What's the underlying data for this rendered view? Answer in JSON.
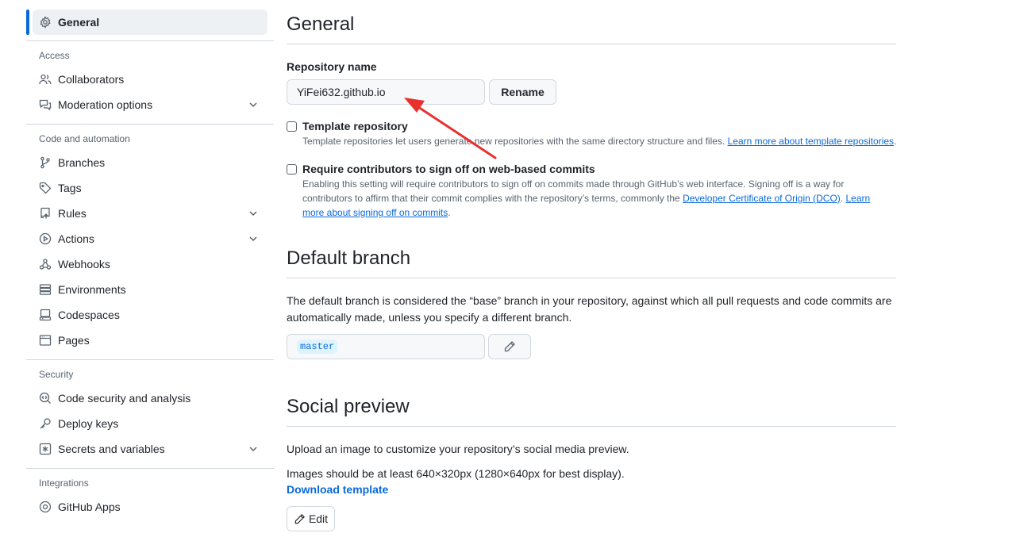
{
  "sidebar": {
    "active": {
      "label": "General",
      "icon": "gear-icon"
    },
    "groups": [
      {
        "title": "Access",
        "items": [
          {
            "label": "Collaborators",
            "icon": "people-icon",
            "expandable": false
          },
          {
            "label": "Moderation options",
            "icon": "comment-discussion-icon",
            "expandable": true
          }
        ]
      },
      {
        "title": "Code and automation",
        "items": [
          {
            "label": "Branches",
            "icon": "git-branch-icon",
            "expandable": false
          },
          {
            "label": "Tags",
            "icon": "tag-icon",
            "expandable": false
          },
          {
            "label": "Rules",
            "icon": "repo-push-icon",
            "expandable": true
          },
          {
            "label": "Actions",
            "icon": "play-icon",
            "expandable": true
          },
          {
            "label": "Webhooks",
            "icon": "webhook-icon",
            "expandable": false
          },
          {
            "label": "Environments",
            "icon": "server-icon",
            "expandable": false
          },
          {
            "label": "Codespaces",
            "icon": "codespaces-icon",
            "expandable": false
          },
          {
            "label": "Pages",
            "icon": "browser-icon",
            "expandable": false
          }
        ]
      },
      {
        "title": "Security",
        "items": [
          {
            "label": "Code security and analysis",
            "icon": "codescan-icon",
            "expandable": false
          },
          {
            "label": "Deploy keys",
            "icon": "key-icon",
            "expandable": false
          },
          {
            "label": "Secrets and variables",
            "icon": "asterisk-icon",
            "expandable": true
          }
        ]
      },
      {
        "title": "Integrations",
        "items": [
          {
            "label": "GitHub Apps",
            "icon": "apps-icon",
            "expandable": false
          }
        ]
      }
    ]
  },
  "general": {
    "title": "General",
    "repo_name_label": "Repository name",
    "repo_name_value": "YiFei632.github.io",
    "rename_button": "Rename",
    "template": {
      "title": "Template repository",
      "note": "Template repositories let users generate new repositories with the same directory structure and files.",
      "link": "Learn more about template repositories",
      "checked": false
    },
    "signoff": {
      "title": "Require contributors to sign off on web-based commits",
      "note_line1": "Enabling this setting will require contributors to sign off on commits made through GitHub’s web interface. Signing off is a way for",
      "note_line2_prefix": "contributors to affirm that their commit complies with the repository’s terms, commonly the ",
      "dco_link": "Developer Certificate of Origin (DCO)",
      "learn_link_part1": "Learn",
      "learn_link_part2": "more about signing off on commits",
      "checked": false
    }
  },
  "default_branch": {
    "title": "Default branch",
    "description_line1": "The default branch is considered the “base” branch in your repository, against which all pull requests and code commits are",
    "description_line2": "automatically made, unless you specify a different branch.",
    "branch": "master"
  },
  "social_preview": {
    "title": "Social preview",
    "line1": "Upload an image to customize your repository’s social media preview.",
    "line2": "Images should be at least 640×320px (1280×640px for best display).",
    "download_link": "Download template",
    "edit_button": "Edit"
  },
  "colors": {
    "accent": "#0969da",
    "annotation_arrow": "#e8312f"
  }
}
